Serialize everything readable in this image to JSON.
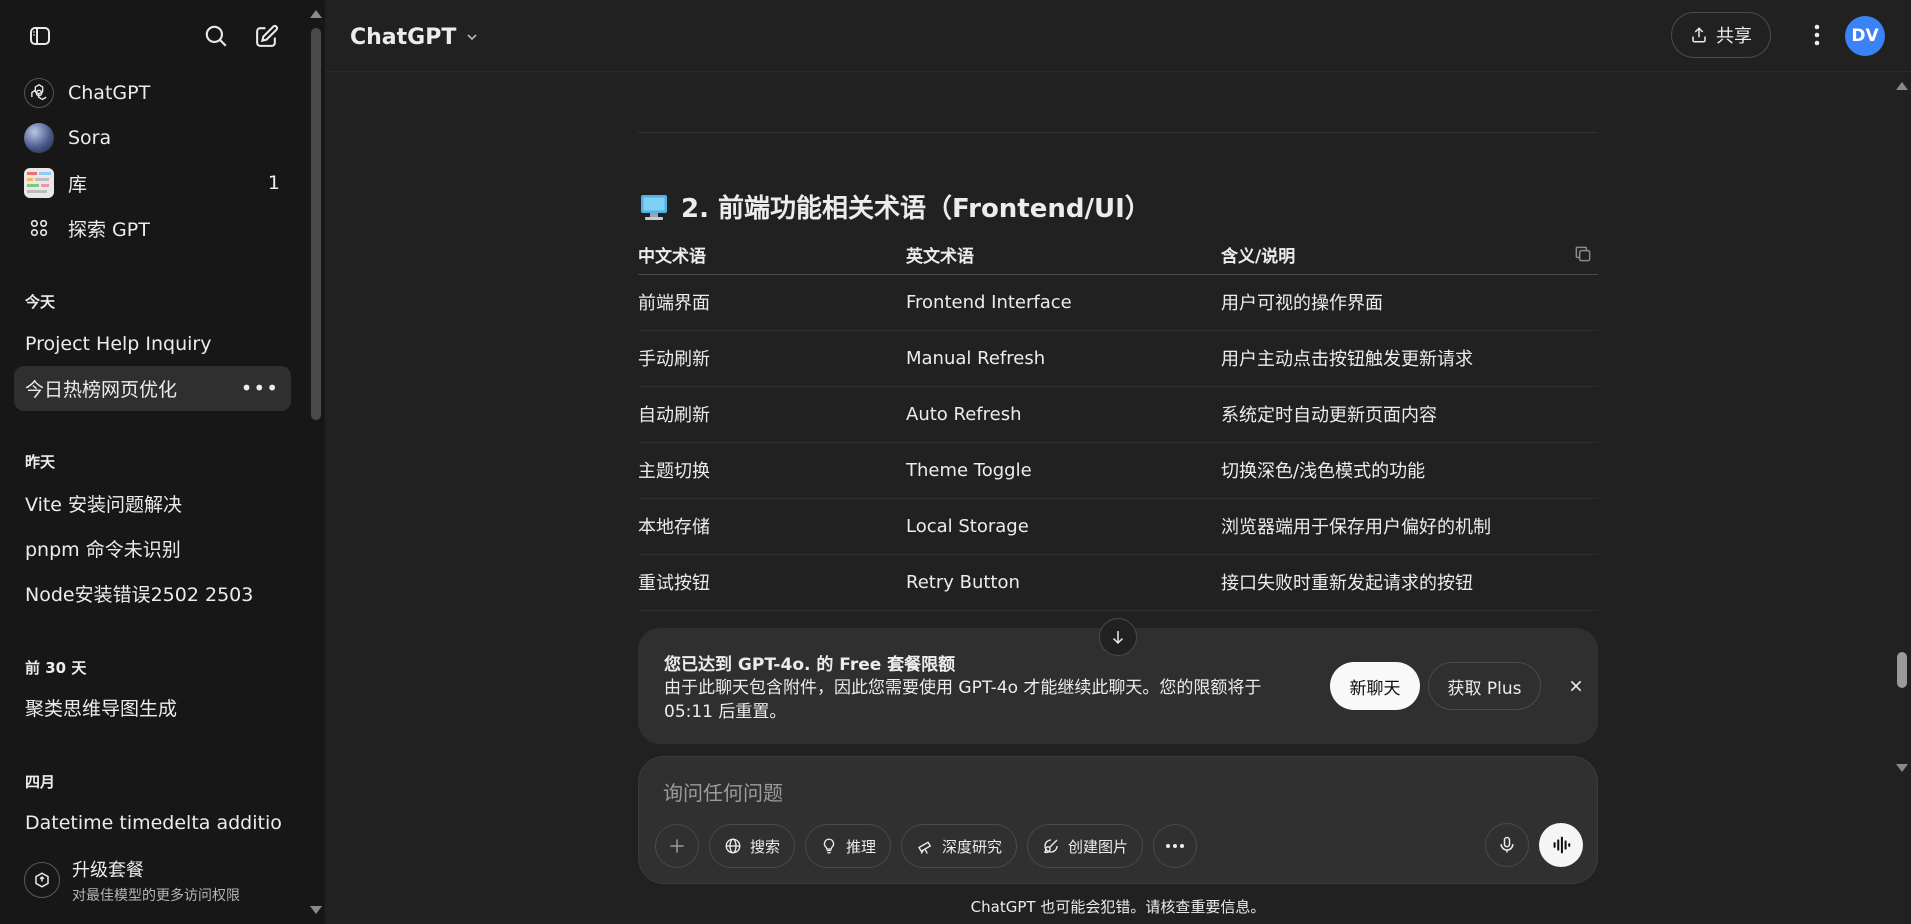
{
  "sidebar": {
    "nav": [
      {
        "label": "ChatGPT",
        "icon": "openai-logo-icon"
      },
      {
        "label": "Sora",
        "icon": "sora-orb-icon"
      },
      {
        "label": "库",
        "icon": "library-thumbnail-icon",
        "count": "1"
      },
      {
        "label": "探索 GPT",
        "icon": "grid-dots-icon"
      }
    ],
    "sections": [
      {
        "title": "今天",
        "items": [
          "Project Help Inquiry",
          "今日热榜网页优化"
        ]
      },
      {
        "title": "昨天",
        "items": [
          "Vite 安装问题解决",
          "pnpm 命令未识别",
          "Node安装错误2502 2503"
        ]
      },
      {
        "title": "前 30 天",
        "items": [
          "聚类思维导图生成"
        ]
      },
      {
        "title": "四月",
        "items": [
          "Datetime timedelta additio"
        ]
      }
    ],
    "upgrade": {
      "title": "升级套餐",
      "subtitle": "对最佳模型的更多访问权限"
    }
  },
  "header": {
    "model": "ChatGPT",
    "share_label": "共享",
    "avatar_initials": "DV"
  },
  "content": {
    "heading": "2. 前端功能相关术语（Frontend/UI）",
    "table": {
      "headers": [
        "中文术语",
        "英文术语",
        "含义/说明"
      ],
      "rows": [
        [
          "前端界面",
          "Frontend Interface",
          "用户可视的操作界面"
        ],
        [
          "手动刷新",
          "Manual Refresh",
          "用户主动点击按钮触发更新请求"
        ],
        [
          "自动刷新",
          "Auto Refresh",
          "系统定时自动更新页面内容"
        ],
        [
          "主题切换",
          "Theme Toggle",
          "切换深色/浅色模式的功能"
        ],
        [
          "本地存储",
          "Local Storage",
          "浏览器端用于保存用户偏好的机制"
        ],
        [
          "重试按钮",
          "Retry Button",
          "接口失败时重新发起请求的按钮"
        ]
      ]
    }
  },
  "limit_banner": {
    "title": "您已达到 GPT-4o. 的 Free 套餐限额",
    "body": "由于此聊天包含附件，因此您需要使用 GPT-4o 才能继续此聊天。您的限额将于 05:11 后重置。",
    "new_chat_label": "新聊天",
    "get_plus_label": "获取 Plus"
  },
  "composer": {
    "placeholder": "询问任何问题",
    "tools": [
      "搜索",
      "推理",
      "深度研究",
      "创建图片"
    ]
  },
  "disclaimer": "ChatGPT 也可能会犯错。请核查重要信息。",
  "colors": {
    "sidebar_bg": "#171717",
    "main_bg": "#212121",
    "surface": "#2f2f2f",
    "avatar": "#3b82f6"
  }
}
